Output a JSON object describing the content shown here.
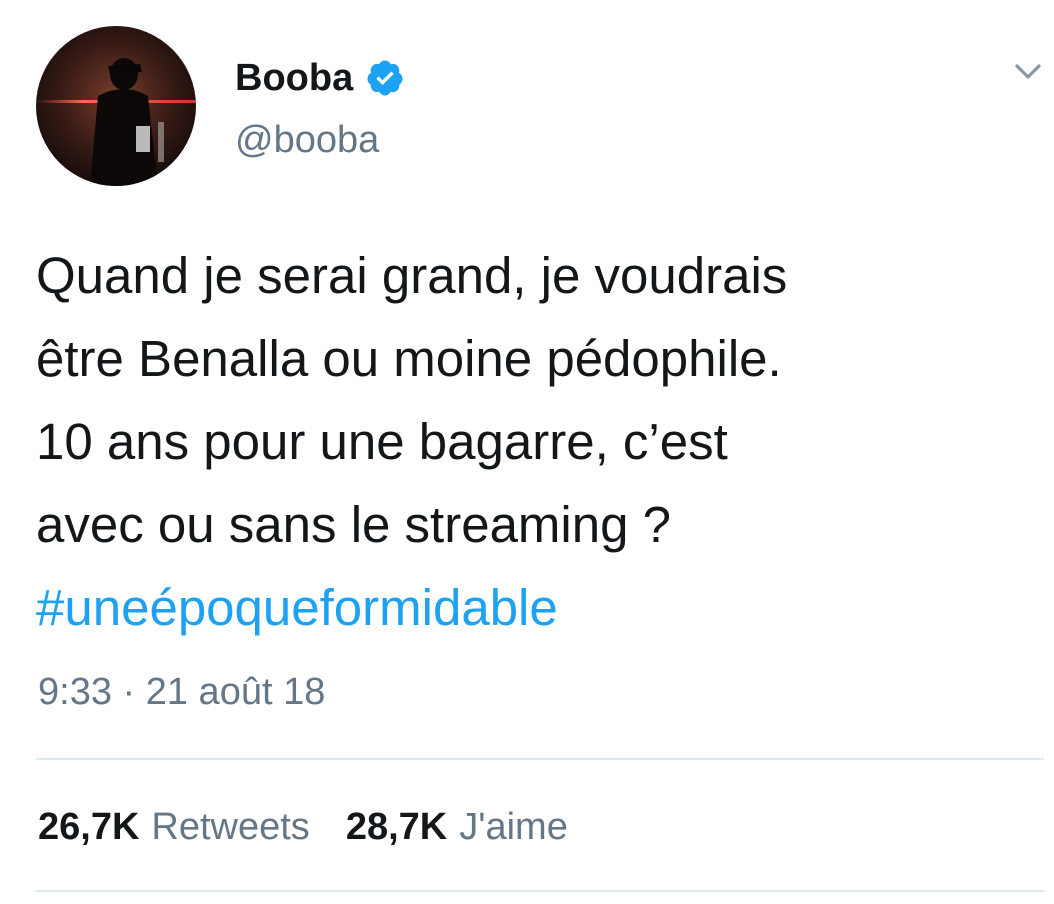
{
  "tweet": {
    "author": {
      "display_name": "Booba",
      "handle": "@booba",
      "verified": true,
      "avatar_icon": "profile-photo"
    },
    "text_lines": [
      "Quand je serai grand, je voudrais",
      "être Benalla ou moine pédophile.",
      "10 ans pour une bagarre, c’est",
      "avec ou sans le streaming ?"
    ],
    "hashtag": "#uneépoqueformidable",
    "timestamp": "9:33 · 21 août 18",
    "stats": {
      "retweets_count": "26,7K",
      "retweets_label": "Retweets",
      "likes_count": "28,7K",
      "likes_label": "J'aime"
    }
  },
  "icons": {
    "verified": "verified-badge-icon",
    "menu": "chevron-down-icon"
  },
  "colors": {
    "link": "#1da1f2",
    "secondary_text": "#657786",
    "primary_text": "#14171a",
    "divider": "#e1e8ed"
  }
}
